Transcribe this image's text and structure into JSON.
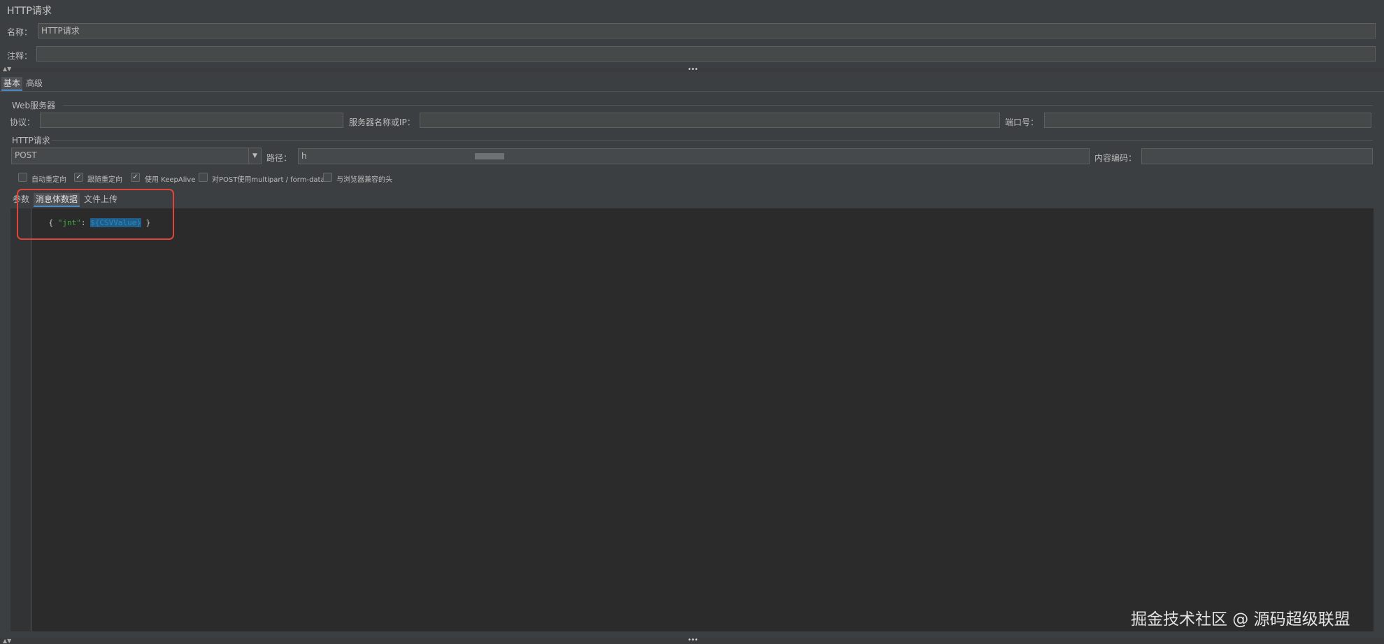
{
  "panel": {
    "title": "HTTP请求"
  },
  "name_row": {
    "label": "名称：",
    "value": "HTTP请求"
  },
  "comment_row": {
    "label": "注释：",
    "value": ""
  },
  "top_tabs": [
    {
      "label": "基本",
      "selected": true
    },
    {
      "label": "高级",
      "selected": false
    }
  ],
  "web_server": {
    "section_title": "Web服务器",
    "protocol_label": "协议：",
    "protocol_value": "",
    "server_label": "服务器名称或IP：",
    "server_value": "",
    "port_label": "端口号：",
    "port_value": ""
  },
  "http_request": {
    "section_title": "HTTP请求",
    "method": "POST",
    "path_label": "路径：",
    "path_value": "h",
    "encoding_label": "内容编码：",
    "encoding_value": ""
  },
  "options": [
    {
      "label": "自动重定向",
      "checked": false
    },
    {
      "label": "跟随重定向",
      "checked": true
    },
    {
      "label": "使用 KeepAlive",
      "checked": true
    },
    {
      "label": "对POST使用multipart / form-data",
      "checked": false
    },
    {
      "label": "与浏览器兼容的头",
      "checked": false
    }
  ],
  "body_tabs": [
    {
      "label": "参数",
      "selected": false
    },
    {
      "label": "消息体数据",
      "selected": true
    },
    {
      "label": "文件上传",
      "selected": false
    }
  ],
  "body_code": {
    "open": "{ ",
    "key": "\"jnt\"",
    "colon": ": ",
    "value": "${CSVValue}",
    "close": " }"
  },
  "watermark": "掘金技术社区 @ 源码超级联盟",
  "colors": {
    "background": "#3c3f41",
    "editor_bg": "#2b2b2b",
    "highlight_box": "#e0443a",
    "code_key": "#6a8759",
    "code_value_bg": "#214283",
    "tab_underline": "#4a88c7"
  }
}
